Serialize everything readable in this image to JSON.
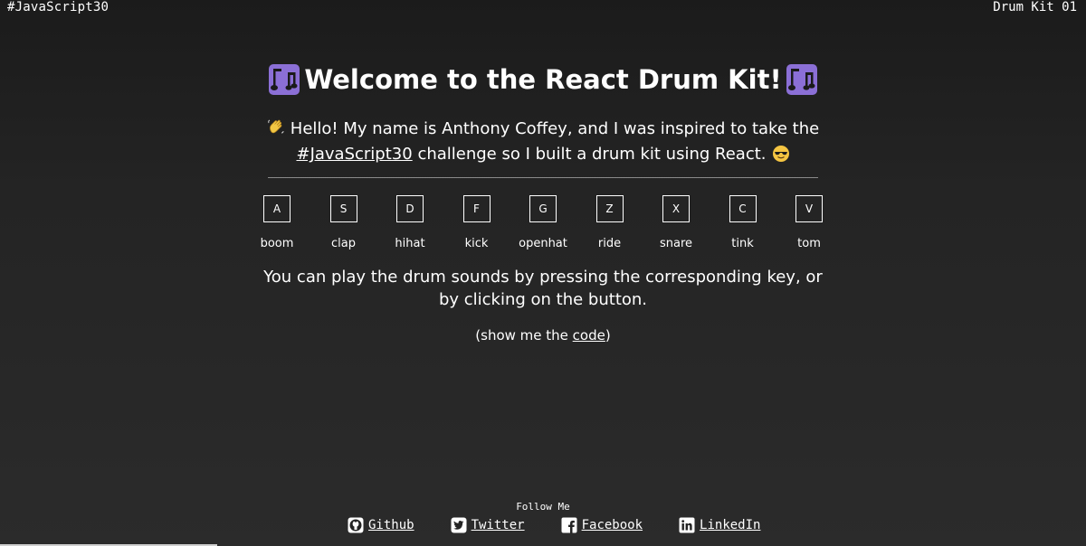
{
  "topbar": {
    "left": "#JavaScript30",
    "right": "Drum Kit 01"
  },
  "header": {
    "title": "Welcome to the React Drum Kit!",
    "icon": "musical-notes-icon"
  },
  "intro": {
    "before": "Hello! My name is Anthony Coffey, and I was inspired to take the",
    "link": "#JavaScript30",
    "after": "challenge so I built a drum kit using React."
  },
  "drums": [
    {
      "key": "A",
      "sound": "boom"
    },
    {
      "key": "S",
      "sound": "clap"
    },
    {
      "key": "D",
      "sound": "hihat"
    },
    {
      "key": "F",
      "sound": "kick"
    },
    {
      "key": "G",
      "sound": "openhat"
    },
    {
      "key": "Z",
      "sound": "ride"
    },
    {
      "key": "X",
      "sound": "snare"
    },
    {
      "key": "C",
      "sound": "tink"
    },
    {
      "key": "V",
      "sound": "tom"
    }
  ],
  "instructions": "You can play the drum sounds by pressing the corresponding key, or by clicking on the button.",
  "code": {
    "before": "(show me the ",
    "link": "code",
    "after": ")"
  },
  "footer": {
    "follow": "Follow Me",
    "links": [
      {
        "label": "Github",
        "icon": "github-icon"
      },
      {
        "label": "Twitter",
        "icon": "twitter-icon"
      },
      {
        "label": "Facebook",
        "icon": "facebook-icon"
      },
      {
        "label": "LinkedIn",
        "icon": "linkedin-icon"
      }
    ]
  },
  "colors": {
    "background": "#242424",
    "text": "#ffffff",
    "note_purple": "#8b6fd6"
  }
}
